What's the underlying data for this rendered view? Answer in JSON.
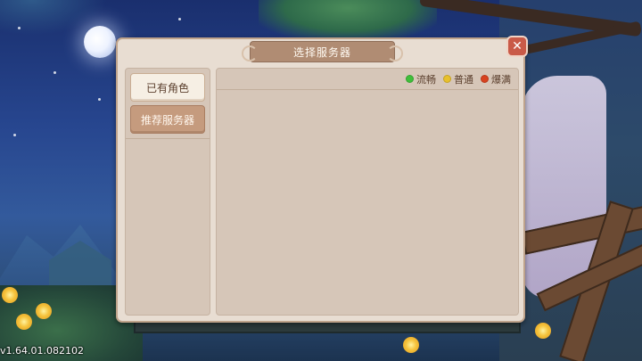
{
  "dialog": {
    "title": "选择服务器",
    "close_symbol": "✕",
    "side_tabs": [
      {
        "label": "已有角色",
        "selected": false
      },
      {
        "label": "推荐服务器",
        "selected": true
      }
    ],
    "legend": [
      {
        "label": "流畅",
        "color": "#3fbf3a"
      },
      {
        "label": "普通",
        "color": "#e8c02c"
      },
      {
        "label": "爆满",
        "color": "#d8421f"
      }
    ]
  },
  "version": "v1.64.01.082102"
}
